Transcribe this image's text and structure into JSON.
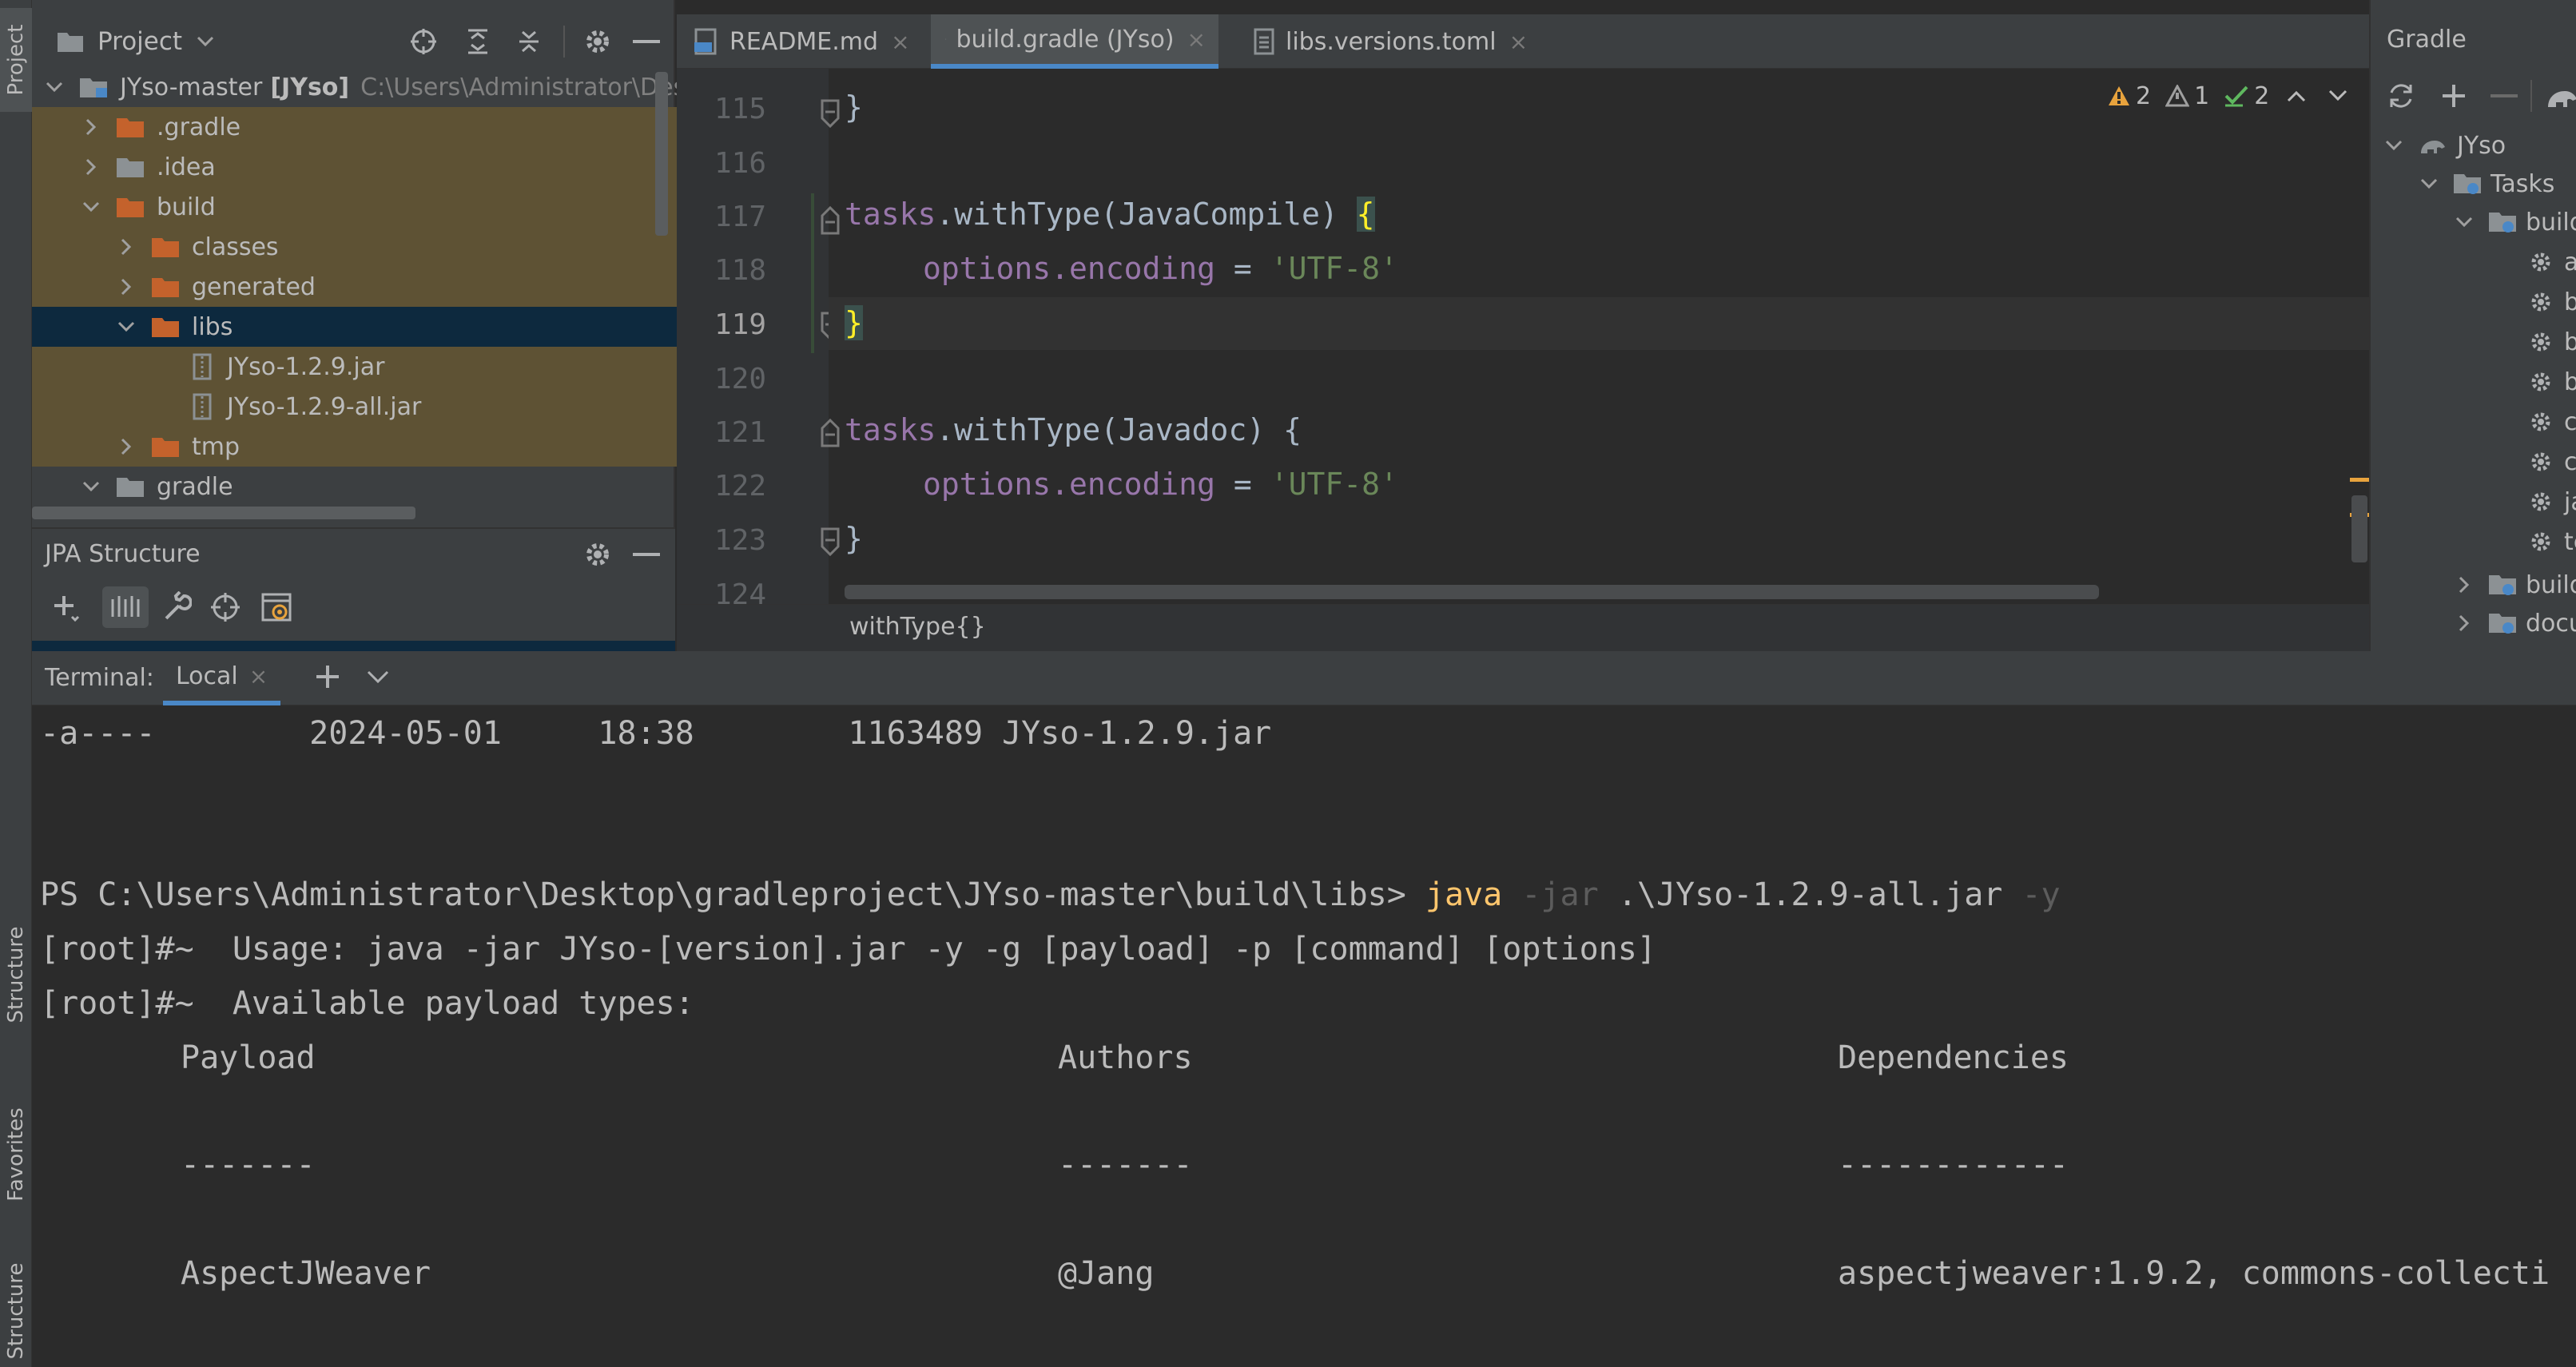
{
  "left_strip": {
    "project_tab": "Project",
    "structure_tab": "Structure",
    "favorites_tab": "Favorites",
    "structure_tab_bottom": "Structure"
  },
  "project": {
    "title": "Project",
    "tree": [
      {
        "label": "JYso-master",
        "bold_suffix": "[JYso]",
        "path": "C:\\Users\\Administrator\\Desk"
      },
      {
        "label": ".gradle"
      },
      {
        "label": ".idea"
      },
      {
        "label": "build"
      },
      {
        "label": "classes"
      },
      {
        "label": "generated"
      },
      {
        "label": "libs"
      },
      {
        "label": "JYso-1.2.9.jar"
      },
      {
        "label": "JYso-1.2.9-all.jar"
      },
      {
        "label": "tmp"
      },
      {
        "label": "gradle"
      }
    ]
  },
  "jpa": {
    "title": "JPA Structure"
  },
  "editor": {
    "tabs": [
      {
        "label": "README.md"
      },
      {
        "label": "build.gradle (JYso)"
      },
      {
        "label": "libs.versions.toml"
      }
    ],
    "inspections": {
      "warnings": "2",
      "weak_warnings": "1",
      "ok": "2"
    },
    "line_numbers": [
      "115",
      "116",
      "117",
      "118",
      "119",
      "120",
      "121",
      "122",
      "123",
      "124"
    ],
    "code": {
      "l115_brace": "}",
      "l117_obj": "tasks",
      "l117_dot": ".",
      "l117_method": "withType(JavaCompile) ",
      "l117_brace": "{",
      "l118_prop": "options.encoding",
      "l118_eq": " = ",
      "l118_val": "'UTF-8'",
      "l119_brace": "}",
      "l121_obj": "tasks",
      "l121_rest": ".withType(Javadoc) {",
      "l122_prop": "options.encoding",
      "l122_eq": " = ",
      "l122_val": "'UTF-8'",
      "l123_brace": "}"
    },
    "breadcrumb": "withType{}"
  },
  "gradle": {
    "title": "Gradle",
    "tree": [
      {
        "label": "JYso"
      },
      {
        "label": "Tasks"
      },
      {
        "label": "build"
      },
      {
        "label": "a"
      },
      {
        "label": "b"
      },
      {
        "label": "b"
      },
      {
        "label": "b"
      },
      {
        "label": "c"
      },
      {
        "label": "c"
      },
      {
        "label": "ja"
      },
      {
        "label": "te"
      },
      {
        "label": "build"
      },
      {
        "label": "docu"
      }
    ]
  },
  "terminal": {
    "label": "Terminal:",
    "tab": "Local",
    "lines": {
      "listing": "-a----        2024-05-01     18:38        1163489 JYso-1.2.9.jar",
      "prompt": "PS C:\\Users\\Administrator\\Desktop\\gradleproject\\JYso-master\\build\\libs> ",
      "cmd_java": "java",
      "cmd_flag1": " -jar",
      "cmd_file": " .\\JYso-1.2.9-all.jar",
      "cmd_flag2": " -y",
      "usage": "[root]#~  Usage: java -jar JYso-[version].jar -y -g [payload] -p [command] [options]",
      "available": "[root]#~  Available payload types:"
    },
    "table": {
      "headers": [
        "Payload",
        "Authors",
        "Dependencies"
      ],
      "separators": [
        "-------",
        "-------",
        "------------"
      ],
      "rows": [
        [
          "AspectJWeaver",
          "@Jang",
          "aspectjweaver:1.9.2, commons-collecti"
        ]
      ]
    }
  },
  "colors": {
    "accent": "#4a88c7",
    "folder": "#c4622c",
    "selection": "#0d293e",
    "highlight": "#5e5234"
  }
}
